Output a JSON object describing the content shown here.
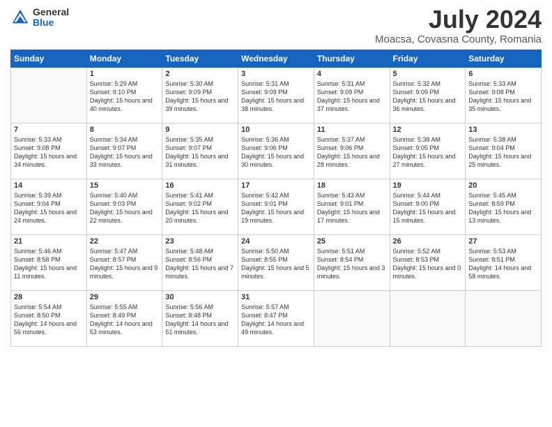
{
  "logo": {
    "general": "General",
    "blue": "Blue"
  },
  "title": "July 2024",
  "location": "Moacsa, Covasna County, Romania",
  "weekdays": [
    "Sunday",
    "Monday",
    "Tuesday",
    "Wednesday",
    "Thursday",
    "Friday",
    "Saturday"
  ],
  "weeks": [
    [
      {
        "day": null
      },
      {
        "day": 1,
        "sunrise": "5:29 AM",
        "sunset": "9:10 PM",
        "daylight": "15 hours and 40 minutes."
      },
      {
        "day": 2,
        "sunrise": "5:30 AM",
        "sunset": "9:09 PM",
        "daylight": "15 hours and 39 minutes."
      },
      {
        "day": 3,
        "sunrise": "5:31 AM",
        "sunset": "9:09 PM",
        "daylight": "15 hours and 38 minutes."
      },
      {
        "day": 4,
        "sunrise": "5:31 AM",
        "sunset": "9:09 PM",
        "daylight": "15 hours and 37 minutes."
      },
      {
        "day": 5,
        "sunrise": "5:32 AM",
        "sunset": "9:09 PM",
        "daylight": "15 hours and 36 minutes."
      },
      {
        "day": 6,
        "sunrise": "5:33 AM",
        "sunset": "9:08 PM",
        "daylight": "15 hours and 35 minutes."
      }
    ],
    [
      {
        "day": 7,
        "sunrise": "5:33 AM",
        "sunset": "9:08 PM",
        "daylight": "15 hours and 34 minutes."
      },
      {
        "day": 8,
        "sunrise": "5:34 AM",
        "sunset": "9:07 PM",
        "daylight": "15 hours and 33 minutes."
      },
      {
        "day": 9,
        "sunrise": "5:35 AM",
        "sunset": "9:07 PM",
        "daylight": "15 hours and 31 minutes."
      },
      {
        "day": 10,
        "sunrise": "5:36 AM",
        "sunset": "9:06 PM",
        "daylight": "15 hours and 30 minutes."
      },
      {
        "day": 11,
        "sunrise": "5:37 AM",
        "sunset": "9:06 PM",
        "daylight": "15 hours and 28 minutes."
      },
      {
        "day": 12,
        "sunrise": "5:38 AM",
        "sunset": "9:05 PM",
        "daylight": "15 hours and 27 minutes."
      },
      {
        "day": 13,
        "sunrise": "5:38 AM",
        "sunset": "9:04 PM",
        "daylight": "15 hours and 25 minutes."
      }
    ],
    [
      {
        "day": 14,
        "sunrise": "5:39 AM",
        "sunset": "9:04 PM",
        "daylight": "15 hours and 24 minutes."
      },
      {
        "day": 15,
        "sunrise": "5:40 AM",
        "sunset": "9:03 PM",
        "daylight": "15 hours and 22 minutes."
      },
      {
        "day": 16,
        "sunrise": "5:41 AM",
        "sunset": "9:02 PM",
        "daylight": "15 hours and 20 minutes."
      },
      {
        "day": 17,
        "sunrise": "5:42 AM",
        "sunset": "9:01 PM",
        "daylight": "15 hours and 19 minutes."
      },
      {
        "day": 18,
        "sunrise": "5:43 AM",
        "sunset": "9:01 PM",
        "daylight": "15 hours and 17 minutes."
      },
      {
        "day": 19,
        "sunrise": "5:44 AM",
        "sunset": "9:00 PM",
        "daylight": "15 hours and 15 minutes."
      },
      {
        "day": 20,
        "sunrise": "5:45 AM",
        "sunset": "8:59 PM",
        "daylight": "15 hours and 13 minutes."
      }
    ],
    [
      {
        "day": 21,
        "sunrise": "5:46 AM",
        "sunset": "8:58 PM",
        "daylight": "15 hours and 11 minutes."
      },
      {
        "day": 22,
        "sunrise": "5:47 AM",
        "sunset": "8:57 PM",
        "daylight": "15 hours and 9 minutes."
      },
      {
        "day": 23,
        "sunrise": "5:48 AM",
        "sunset": "8:56 PM",
        "daylight": "15 hours and 7 minutes."
      },
      {
        "day": 24,
        "sunrise": "5:50 AM",
        "sunset": "8:55 PM",
        "daylight": "15 hours and 5 minutes."
      },
      {
        "day": 25,
        "sunrise": "5:51 AM",
        "sunset": "8:54 PM",
        "daylight": "15 hours and 3 minutes."
      },
      {
        "day": 26,
        "sunrise": "5:52 AM",
        "sunset": "8:53 PM",
        "daylight": "15 hours and 0 minutes."
      },
      {
        "day": 27,
        "sunrise": "5:53 AM",
        "sunset": "8:51 PM",
        "daylight": "14 hours and 58 minutes."
      }
    ],
    [
      {
        "day": 28,
        "sunrise": "5:54 AM",
        "sunset": "8:50 PM",
        "daylight": "14 hours and 56 minutes."
      },
      {
        "day": 29,
        "sunrise": "5:55 AM",
        "sunset": "8:49 PM",
        "daylight": "14 hours and 53 minutes."
      },
      {
        "day": 30,
        "sunrise": "5:56 AM",
        "sunset": "8:48 PM",
        "daylight": "14 hours and 51 minutes."
      },
      {
        "day": 31,
        "sunrise": "5:57 AM",
        "sunset": "8:47 PM",
        "daylight": "14 hours and 49 minutes."
      },
      {
        "day": null
      },
      {
        "day": null
      },
      {
        "day": null
      }
    ]
  ]
}
